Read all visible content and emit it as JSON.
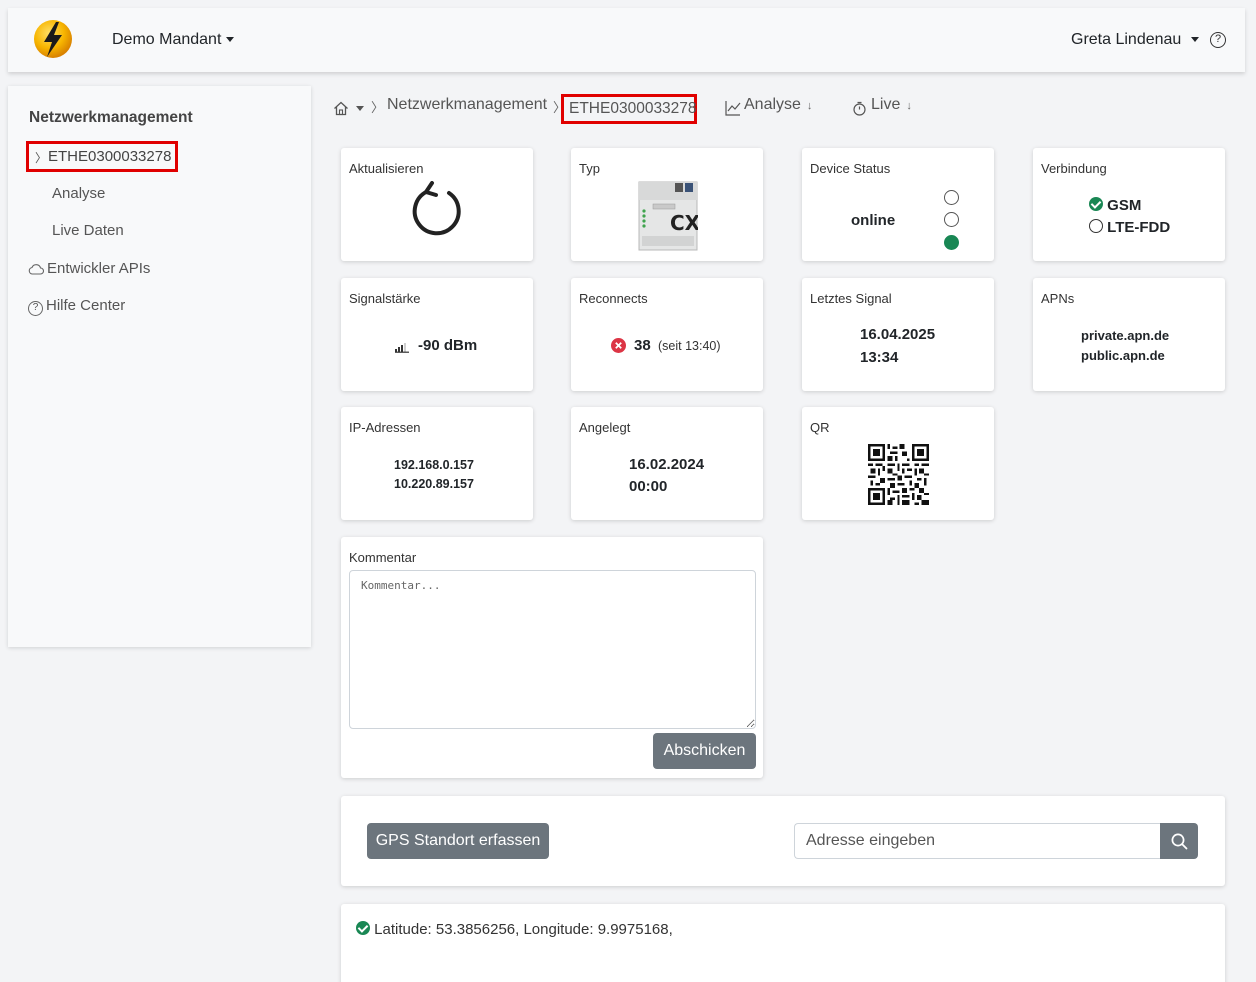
{
  "nav": {
    "tenant": "Demo Mandant",
    "user": "Greta Lindenau",
    "help": "?"
  },
  "sidebar": {
    "title": "Netzwerkmanagement",
    "active_device": "ETHE0300033278",
    "items": [
      {
        "label": "Analyse"
      },
      {
        "label": "Live Daten"
      },
      {
        "label": "Entwickler APIs"
      },
      {
        "label": "Hilfe Center"
      }
    ]
  },
  "breadcrumb": {
    "section": "Netzwerkmanagement",
    "device": "ETHE0300033278",
    "analyse": "Analyse",
    "live": "Live"
  },
  "cards": {
    "refresh_label": "Aktualisieren",
    "type_label": "Typ",
    "type_model": "CX",
    "status_label": "Device Status",
    "status_value": "online",
    "connection_label": "Verbindung",
    "connection_options": [
      "GSM",
      "LTE-FDD"
    ],
    "signal_label": "Signalstärke",
    "signal_value": "-90 dBm",
    "reconnects_label": "Reconnects",
    "reconnects_count": "38",
    "reconnects_since": "(seit 13:40)",
    "last_signal_label": "Letztes Signal",
    "last_signal_date": "16.04.2025",
    "last_signal_time": "13:34",
    "apns_label": "APNs",
    "apns": [
      "private.apn.de",
      "public.apn.de"
    ],
    "ip_label": "IP-Adressen",
    "ips": [
      "192.168.0.157",
      "10.220.89.157"
    ],
    "created_label": "Angelegt",
    "created_date": "16.02.2024",
    "created_time": "00:00",
    "qr_label": "QR"
  },
  "comment": {
    "label": "Kommentar",
    "placeholder": "Kommentar...",
    "submit": "Abschicken"
  },
  "gps": {
    "button": "GPS Standort erfassen",
    "address_placeholder": "Adresse eingeben",
    "result": "Latitude: 53.3856256, Longitude: 9.9975168,"
  },
  "colors": {
    "accent_green": "#198754",
    "highlight_red": "#e00000",
    "button_gray": "#6c757d",
    "error_red": "#dc3545"
  }
}
